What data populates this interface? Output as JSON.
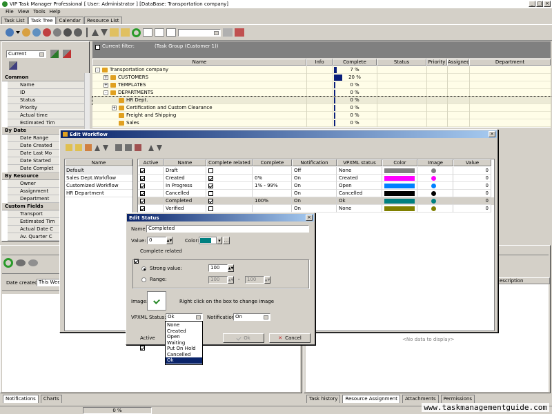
{
  "app": {
    "title": "VIP Task Manager Professional [ User: Administrator ] [DataBase: Transportation company]"
  },
  "menu": [
    "File",
    "View",
    "Tools",
    "Help"
  ],
  "tabs": [
    "Task List",
    "Task Tree",
    "Calendar",
    "Resource List"
  ],
  "active_tab": 1,
  "filter_bar": {
    "label": "Current filter:",
    "value": "(Task Group (Customer 1))"
  },
  "left_panel": {
    "view_select": "Current"
  },
  "sidebar": [
    {
      "group": "Common",
      "items": [
        "Name",
        "ID",
        "Status",
        "Priority",
        "Actual time",
        "Estimated Tim"
      ]
    },
    {
      "group": "By Date",
      "items": [
        "Date Range",
        "Date Created",
        "Date Last Mo",
        "Date Started",
        "Date Complet"
      ]
    },
    {
      "group": "By Resource",
      "items": [
        "Owner",
        "Assignment",
        "Department"
      ]
    },
    {
      "group": "Custom Fields",
      "items": [
        "Transport",
        "Estimated Tim",
        "Actual Date C",
        "Av. Quarter C"
      ]
    }
  ],
  "sidebar_dropdown_items": [
    "Status",
    "Priority",
    "Actual time",
    "Estimated Tim",
    "Owner",
    "Assignment",
    "Department",
    "Transport",
    "Estimated Tim",
    "Actual Date C",
    "Av. Quarter C"
  ],
  "tree": {
    "columns": [
      "Name",
      "Info",
      "Complete",
      "Status",
      "Priority",
      "Assigned",
      "Department"
    ],
    "rows": [
      {
        "name": "Transportation company",
        "complete": "7 %",
        "progress": 0.07,
        "level": 0,
        "expander": "-"
      },
      {
        "name": "CUSTOMERS",
        "complete": "20 %",
        "progress": 0.2,
        "level": 1,
        "expander": "+"
      },
      {
        "name": "TEMPLATES",
        "complete": "0 %",
        "progress": 0,
        "level": 1,
        "expander": "+"
      },
      {
        "name": "DEPARTMENTS",
        "complete": "0 %",
        "progress": 0,
        "level": 1,
        "expander": "-"
      },
      {
        "name": "HR Dept.",
        "complete": "0 %",
        "progress": 0,
        "level": 2,
        "expander": ""
      },
      {
        "name": "Certification and Custom Clearance",
        "complete": "0 %",
        "progress": 0,
        "level": 2,
        "expander": "+"
      },
      {
        "name": "Freight and Shipping",
        "complete": "0 %",
        "progress": 0,
        "level": 2,
        "expander": ""
      },
      {
        "name": "Sales",
        "complete": "0 %",
        "progress": 0,
        "level": 2,
        "expander": ""
      }
    ]
  },
  "bottom_left": {
    "date_created_label": "Date created:",
    "date_created_value": "This Week"
  },
  "bottom_right": {
    "description_header": "escription",
    "no_data": "<No data to display>"
  },
  "bottom_tabs_left": [
    "Notifications",
    "Charts"
  ],
  "bottom_tabs_right": [
    "Task history",
    "Resource Assignment",
    "Attachments",
    "Permissions"
  ],
  "status_bar": {
    "value": "0 %"
  },
  "watermark": "www.taskmanagementguide.com",
  "edit_workflow": {
    "title": "Edit Workflow",
    "list_header": "Name",
    "workflows": [
      "Default",
      "Sales Dept.Workflow",
      "Customized Workflow",
      "HR Department"
    ],
    "columns": [
      "Active",
      "Name",
      "Complete related",
      "Complete",
      "Notification",
      "VPXML status",
      "Color",
      "Image",
      "Value"
    ],
    "rows": [
      {
        "active": true,
        "name": "Draft",
        "complete_related": false,
        "complete": "",
        "notification": "Off",
        "vpxml": "None",
        "color": "#808080",
        "value": "0"
      },
      {
        "active": true,
        "name": "Created",
        "complete_related": true,
        "complete": "0%",
        "notification": "On",
        "vpxml": "Created",
        "color": "#ff00ff",
        "value": "0"
      },
      {
        "active": true,
        "name": "In Progress",
        "complete_related": true,
        "complete": "1% - 99%",
        "notification": "On",
        "vpxml": "Open",
        "color": "#0080ff",
        "value": "0"
      },
      {
        "active": true,
        "name": "Cancelled",
        "complete_related": false,
        "complete": "",
        "notification": "On",
        "vpxml": "Cancelled",
        "color": "#000000",
        "value": "0"
      },
      {
        "active": true,
        "name": "Completed",
        "complete_related": true,
        "complete": "100%",
        "notification": "On",
        "vpxml": "Ok",
        "color": "#008080",
        "value": "0"
      },
      {
        "active": true,
        "name": "Verified",
        "complete_related": false,
        "complete": "",
        "notification": "On",
        "vpxml": "None",
        "color": "#808000",
        "value": "0"
      }
    ]
  },
  "edit_status": {
    "title": "Edit Status",
    "name_label": "Name",
    "name_value": "Completed",
    "value_label": "Value:",
    "value_value": "0",
    "color_label": "Color:",
    "color_value": "#008080",
    "complete_related_label": "Complete related",
    "strong_label": "Strong value:",
    "strong_value": "100",
    "range_label": "Range:",
    "range_from": "100",
    "range_sep": "-",
    "range_to": "100",
    "image_label": "Image:",
    "image_hint": "Right click on the box to  change image",
    "vpxml_label": "VPXML Status:",
    "vpxml_value": "Ok",
    "notification_label": "Notification:",
    "notification_value": "On",
    "vpxml_options": [
      "None",
      "Created",
      "Open",
      "Waiting",
      "Put On Hold",
      "Cancelled",
      "Ok"
    ],
    "active_label": "Active",
    "ok_label": "Ok",
    "cancel_label": "Cancel"
  }
}
